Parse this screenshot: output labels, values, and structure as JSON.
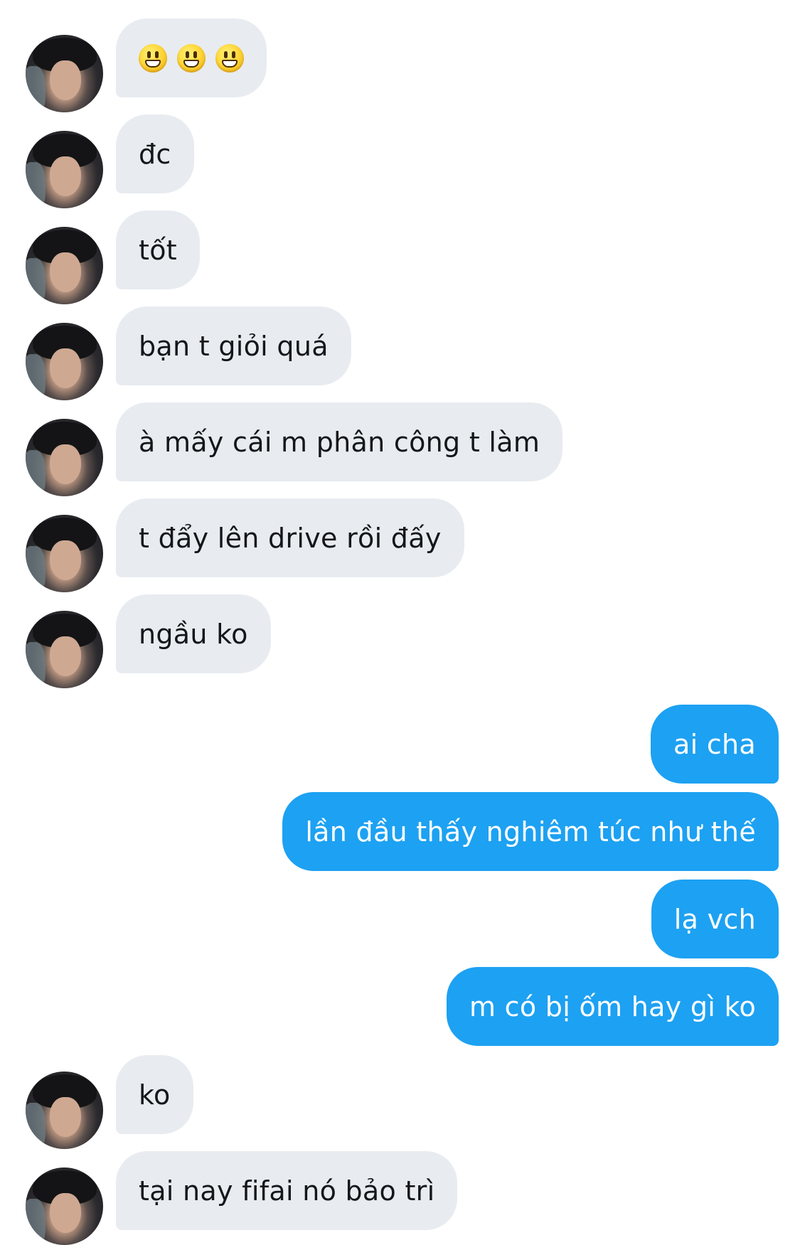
{
  "conversation": {
    "messages": [
      {
        "sender": "them",
        "text": "😃😃😃",
        "emoji_icons": [
          "smiley-emoji",
          "smiley-emoji",
          "smiley-emoji"
        ]
      },
      {
        "sender": "them",
        "text": "đc"
      },
      {
        "sender": "them",
        "text": "tốt"
      },
      {
        "sender": "them",
        "text": "bạn t giỏi quá"
      },
      {
        "sender": "them",
        "text": "à mấy cái m phân công t làm"
      },
      {
        "sender": "them",
        "text": "t đẩy lên drive rồi đấy"
      },
      {
        "sender": "them",
        "text": "ngầu ko"
      },
      {
        "sender": "me",
        "text": "ai cha"
      },
      {
        "sender": "me",
        "text": "lần đầu thấy nghiêm túc như thế"
      },
      {
        "sender": "me",
        "text": "lạ vch"
      },
      {
        "sender": "me",
        "text": "m có bị ốm hay gì ko"
      },
      {
        "sender": "them",
        "text": "ko"
      },
      {
        "sender": "them",
        "text": "tại nay fifai nó bảo trì"
      }
    ]
  },
  "colors": {
    "incoming_bubble": "#e8ecf0",
    "outgoing_bubble": "#1da1f2",
    "incoming_text": "#14171a",
    "outgoing_text": "#ffffff",
    "background": "#ffffff"
  }
}
